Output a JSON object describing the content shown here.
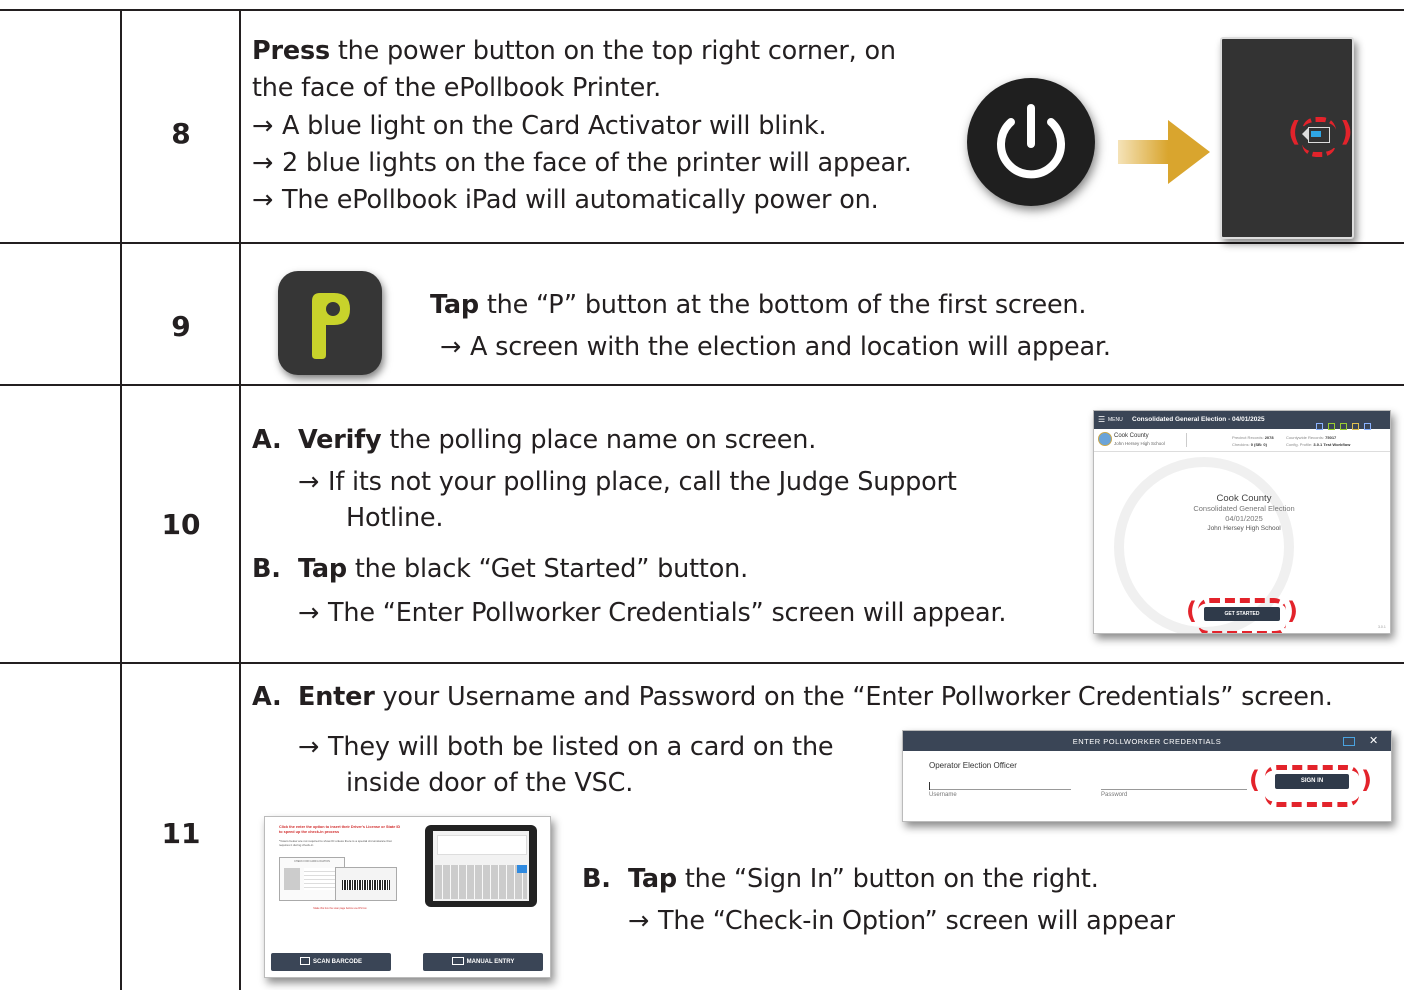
{
  "steps": [
    {
      "number": "8",
      "lines": [
        {
          "bold": "Press",
          "rest": " the power button on the top right corner, on"
        },
        {
          "text": "the face of the ePollbook Printer."
        },
        {
          "arrow": "→",
          "text": "A blue light on the Card Activator will blink."
        },
        {
          "arrow": "→",
          "text": "2 blue lights on the face of the printer will appear."
        },
        {
          "arrow": "→",
          "text": "The ePollbook iPad will automatically power on."
        }
      ]
    },
    {
      "number": "9",
      "lines": [
        {
          "bold": "Tap",
          "rest": " the “P” button at the bottom of the first screen."
        },
        {
          "arrow": "→",
          "text": "A screen  with the election and location will appear."
        }
      ]
    },
    {
      "number": "10",
      "lines": [
        {
          "label": "A.",
          "bold": "Verify",
          "rest": " the polling place name on screen."
        },
        {
          "arrow": "→",
          "text": "If its not your polling place, call the Judge Support"
        },
        {
          "text": "Hotline."
        },
        {
          "label": "B.",
          "bold": "Tap",
          "rest": " the black “Get Started” button."
        },
        {
          "arrow": "→",
          "text": "The “Enter Pollworker Credentials” screen will appear."
        }
      ]
    },
    {
      "number": "11",
      "lines": [
        {
          "label": "A.",
          "bold": "Enter",
          "rest": " your Username and Password on the “Enter Pollworker Credentials” screen."
        },
        {
          "arrow": "→",
          "text": "They will both be listed on a card on the"
        },
        {
          "text": "inside door of the VSC."
        },
        {
          "label": "B.",
          "bold": "Tap",
          "rest": " the “Sign In” button on the right."
        },
        {
          "arrow": "→",
          "text": "The “Check-in Option” screen will appear"
        }
      ]
    }
  ],
  "screen10": {
    "header_title": "Consolidated General Election - 04/01/2025",
    "menu_label": "MENU",
    "org": "Cook County",
    "location": "John Hersey High School",
    "precinct_records_label": "Precinct Records:",
    "precinct_records": "2078",
    "checkins_label": "Checkins:",
    "checkins": "0 (SB: 0)",
    "countywide_label": "Countywide Records:",
    "countywide": "75017",
    "config_label": "Config. Profile:",
    "config": "3.0.1 Test Workflow",
    "center_org": "Cook County",
    "center_election": "Consolidated General Election",
    "center_date": "04/01/2025",
    "center_location": "John Hersey High School",
    "button": "GET STARTED",
    "version": "3.0.1"
  },
  "screen11": {
    "header_title": "ENTER POLLWORKER CREDENTIALS",
    "close_glyph": "✕",
    "role": "Operator Election Officer",
    "username_label": "Username",
    "password_label": "Password",
    "button": "SIGN IN"
  },
  "checkin_screen": {
    "notice": "Click the enter the option to insert their Driver's License or State ID to speed up the check-in process",
    "subnotice": "*Voters below are not required to show ID unless there is a special circumstance that requires it during check-in",
    "id_title": "CHECK FOR CARD LOCATION",
    "footnote": "Make this box the scan page before use DS box",
    "scan_button": "SCAN BARCODE",
    "manual_button": "MANUAL ENTRY"
  },
  "power_glyph": "⏻",
  "p_logo_letter": "P",
  "paren_left": "(",
  "paren_right": ")",
  "colors": {
    "line": "#231f20",
    "red_dash": "#e3232b",
    "p_logo_bg": "#363636",
    "p_logo_fg": "#c8d32b",
    "arrow_gold": "#d9a52e",
    "dark_button": "#2f3a4a"
  }
}
